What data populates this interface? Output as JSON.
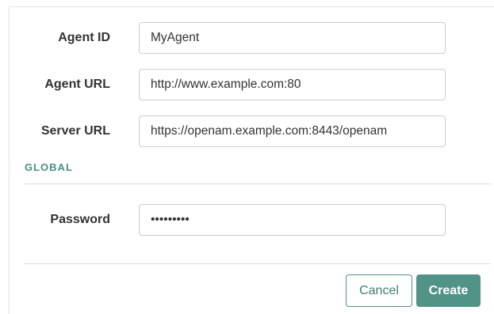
{
  "form": {
    "agent_id": {
      "label": "Agent ID",
      "value": "MyAgent"
    },
    "agent_url": {
      "label": "Agent URL",
      "value": "http://www.example.com:80"
    },
    "server_url": {
      "label": "Server URL",
      "value": "https://openam.example.com:8443/openam"
    },
    "global_section": {
      "title": "GLOBAL"
    },
    "password": {
      "label": "Password",
      "value": "•••••••••"
    }
  },
  "actions": {
    "cancel_label": "Cancel",
    "create_label": "Create"
  },
  "colors": {
    "accent": "#519387",
    "section_title": "#4a9081"
  }
}
